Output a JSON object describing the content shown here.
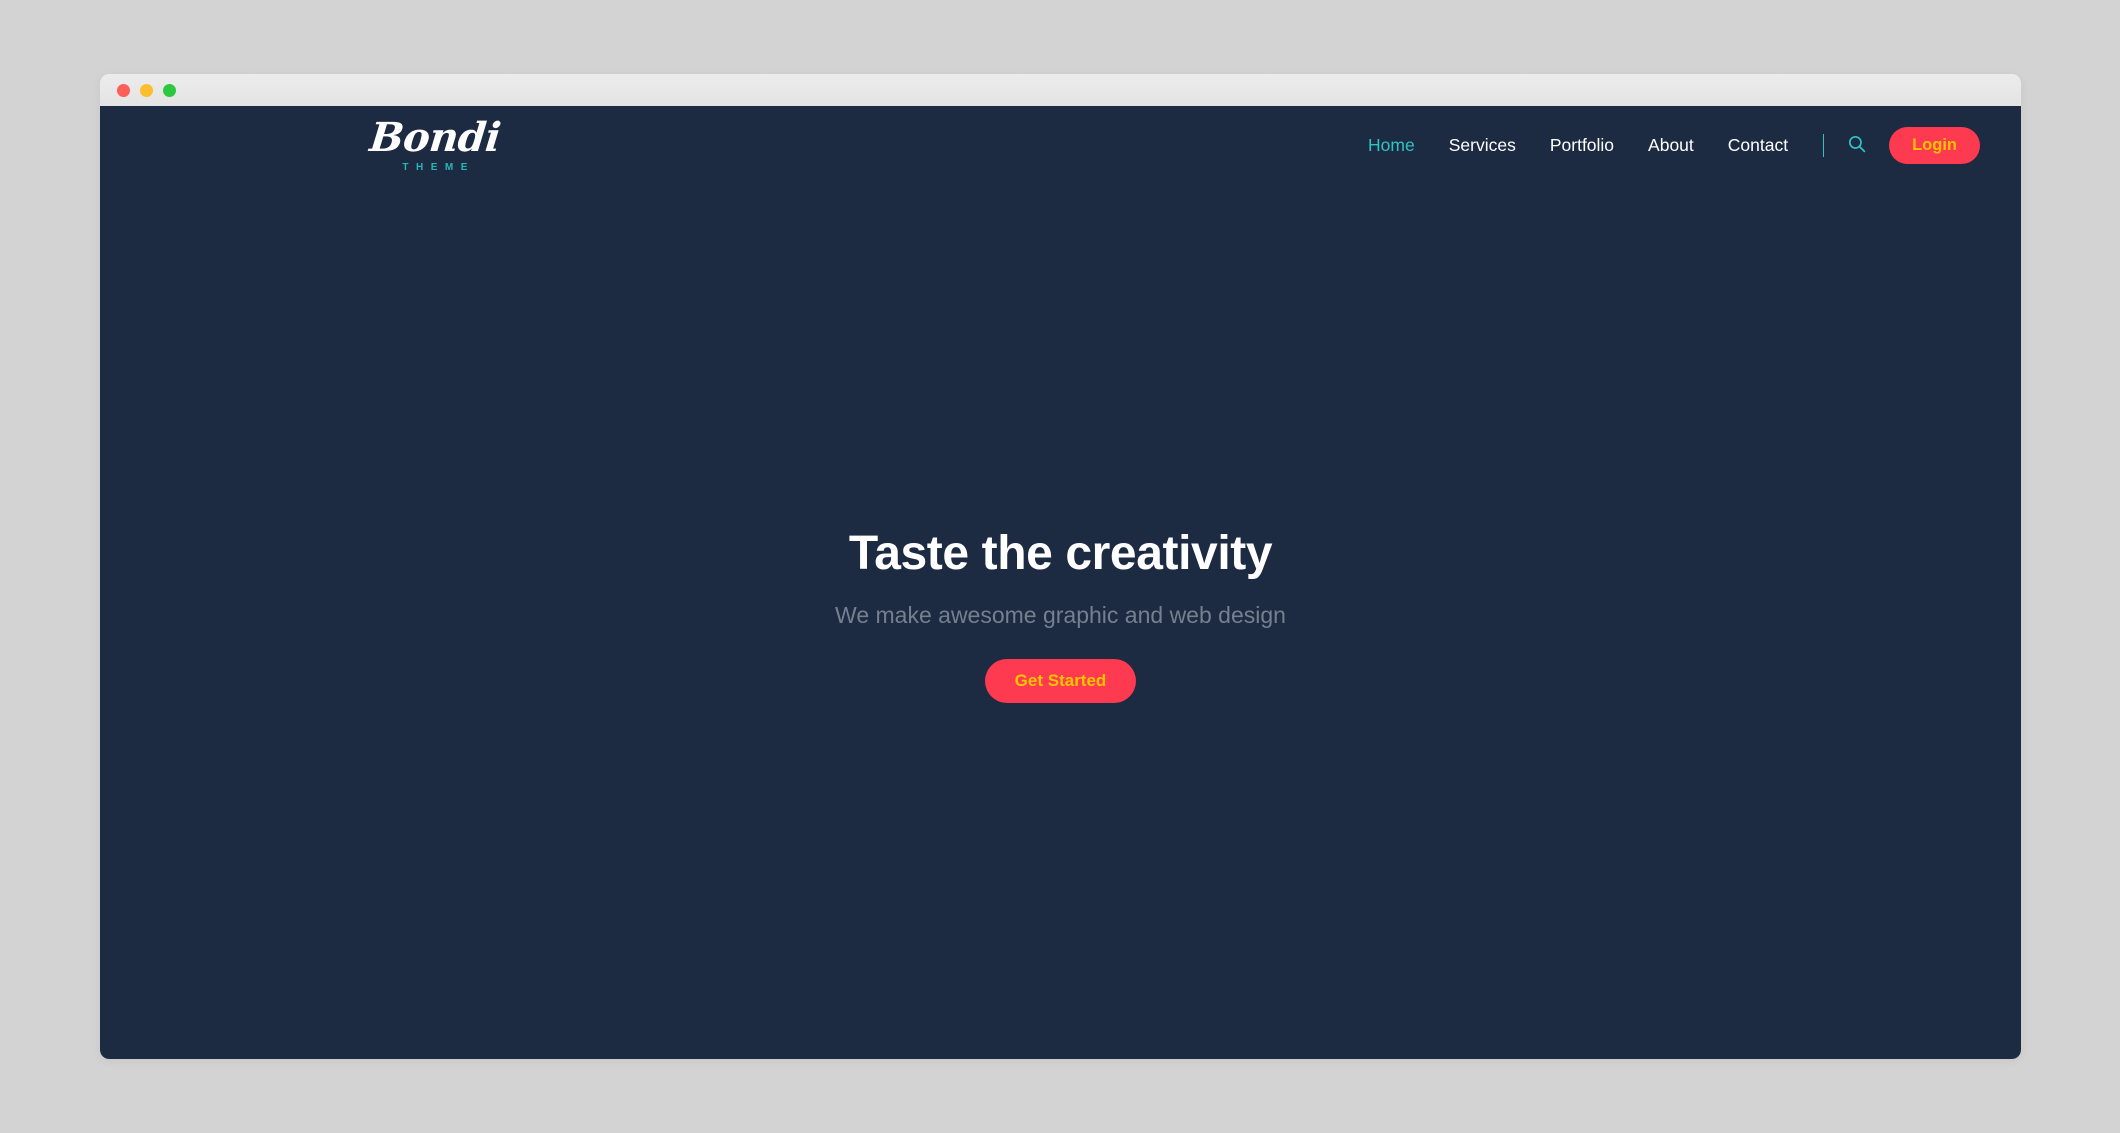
{
  "window": {
    "traffic_lights": [
      {
        "name": "close",
        "color": "#fb5f57"
      },
      {
        "name": "minimize",
        "color": "#fbbe2e"
      },
      {
        "name": "maximize",
        "color": "#2bc840"
      }
    ]
  },
  "brand": {
    "wordmark": "Bondi",
    "tagline": "THEME",
    "tagline_color": "#27b7b7"
  },
  "nav": {
    "items": [
      {
        "label": "Home",
        "active": true
      },
      {
        "label": "Services",
        "active": false
      },
      {
        "label": "Portfolio",
        "active": false
      },
      {
        "label": "About",
        "active": false
      },
      {
        "label": "Contact",
        "active": false
      }
    ],
    "search_icon": "search-icon",
    "login_label": "Login"
  },
  "hero": {
    "title": "Taste the creativity",
    "subtitle": "We make awesome graphic and web design",
    "cta_label": "Get Started"
  },
  "colors": {
    "page_background": "#d3d3d3",
    "titlebar": "#e9e9e9",
    "hero_background": "#1c2a42",
    "accent_teal": "#2ec4c4",
    "accent_red": "#fd3a4f",
    "accent_yellow": "#ffc400",
    "subtitle_gray": "#75808f"
  }
}
